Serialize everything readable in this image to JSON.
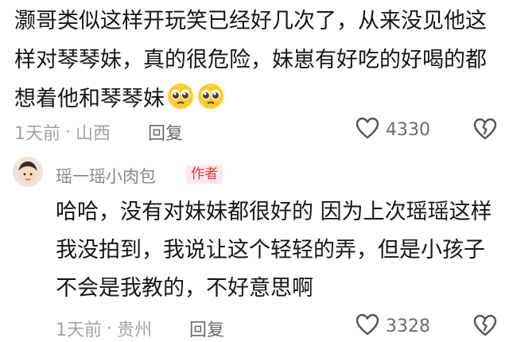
{
  "comment": {
    "text": "灏哥类似这样开玩笑已经好几次了，从来没见他这样对琴琴妹，真的很危险，妹崽有好吃的好喝的都想着他和琴琴妹",
    "emojis": [
      "pleading-face-emoji",
      "pleading-face-emoji"
    ],
    "time": "1天前",
    "separator": "·",
    "location": "山西",
    "reply_label": "回复",
    "like_count": "4330"
  },
  "reply": {
    "author": "瑶一瑶小肉包",
    "badge": "作者",
    "text": "哈哈，没有对妹妹都很好的 因为上次瑶瑶这样我没拍到，我说让这个轻轻的弄，但是小孩子不会是我教的，不好意思啊",
    "time": "1天前",
    "separator": "·",
    "location": "贵州",
    "reply_label": "回复",
    "like_count": "3328"
  },
  "colors": {
    "badge_text": "#ee2d4a",
    "badge_bg": "#fde8ea",
    "meta": "#a3a3a3"
  },
  "icons": [
    "heart-outline-icon",
    "broken-heart-icon",
    "pleading-face-emoji",
    "avatar-photo"
  ]
}
